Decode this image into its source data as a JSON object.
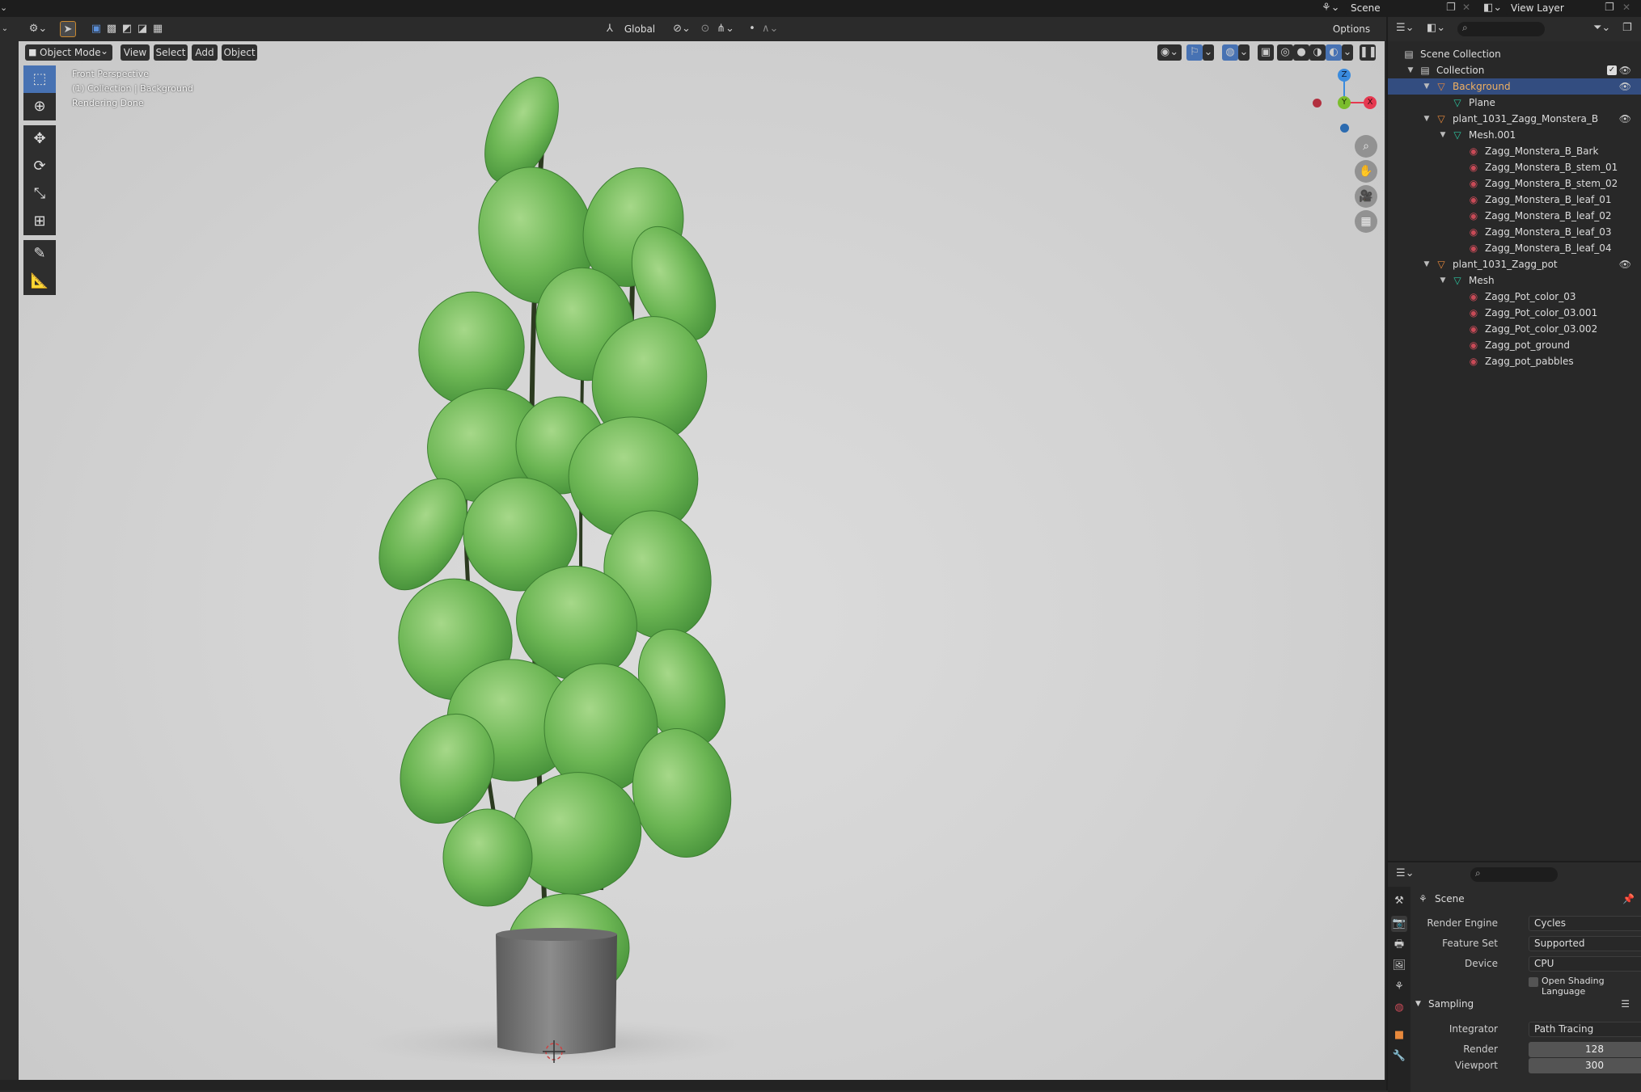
{
  "topbar": {
    "scene_name": "Scene",
    "view_layer_name": "View Layer"
  },
  "viewport_header": {
    "transform_orientation": "Global",
    "options_label": "Options"
  },
  "viewport": {
    "mode": "Object Mode",
    "menus": [
      "View",
      "Select",
      "Add",
      "Object"
    ],
    "overlay_lines": [
      "Front Perspective",
      "(1) Collection | Background",
      "Rendering Done"
    ],
    "gizmo_axes": {
      "z": "Z",
      "y": "Y",
      "x": "X"
    }
  },
  "outliner": {
    "rows": [
      {
        "label": "Scene Collection",
        "type": "scene-collection",
        "depth": 0,
        "selected": false,
        "eye": false
      },
      {
        "label": "Collection",
        "type": "collection",
        "depth": 1,
        "selected": false,
        "eye": true
      },
      {
        "label": "Background",
        "type": "object",
        "depth": 2,
        "selected": true,
        "eye": true
      },
      {
        "label": "Plane",
        "type": "mesh",
        "depth": 3,
        "selected": false,
        "eye": false
      },
      {
        "label": "plant_1031_Zagg_Monstera_B",
        "type": "object",
        "depth": 2,
        "selected": false,
        "eye": true
      },
      {
        "label": "Mesh.001",
        "type": "mesh",
        "depth": 3,
        "selected": false,
        "eye": false
      },
      {
        "label": "Zagg_Monstera_B_Bark",
        "type": "material",
        "depth": 4,
        "selected": false,
        "eye": false
      },
      {
        "label": "Zagg_Monstera_B_stem_01",
        "type": "material",
        "depth": 4,
        "selected": false,
        "eye": false
      },
      {
        "label": "Zagg_Monstera_B_stem_02",
        "type": "material",
        "depth": 4,
        "selected": false,
        "eye": false
      },
      {
        "label": "Zagg_Monstera_B_leaf_01",
        "type": "material",
        "depth": 4,
        "selected": false,
        "eye": false
      },
      {
        "label": "Zagg_Monstera_B_leaf_02",
        "type": "material",
        "depth": 4,
        "selected": false,
        "eye": false
      },
      {
        "label": "Zagg_Monstera_B_leaf_03",
        "type": "material",
        "depth": 4,
        "selected": false,
        "eye": false
      },
      {
        "label": "Zagg_Monstera_B_leaf_04",
        "type": "material",
        "depth": 4,
        "selected": false,
        "eye": false
      },
      {
        "label": "plant_1031_Zagg_pot",
        "type": "object",
        "depth": 2,
        "selected": false,
        "eye": true
      },
      {
        "label": "Mesh",
        "type": "mesh",
        "depth": 3,
        "selected": false,
        "eye": false
      },
      {
        "label": "Zagg_Pot_color_03",
        "type": "material",
        "depth": 4,
        "selected": false,
        "eye": false
      },
      {
        "label": "Zagg_Pot_color_03.001",
        "type": "material",
        "depth": 4,
        "selected": false,
        "eye": false
      },
      {
        "label": "Zagg_Pot_color_03.002",
        "type": "material",
        "depth": 4,
        "selected": false,
        "eye": false
      },
      {
        "label": "Zagg_pot_ground",
        "type": "material",
        "depth": 4,
        "selected": false,
        "eye": false
      },
      {
        "label": "Zagg_pot_pabbles",
        "type": "material",
        "depth": 4,
        "selected": false,
        "eye": false
      }
    ]
  },
  "properties": {
    "context_title": "Scene",
    "render_engine_label": "Render Engine",
    "render_engine_value": "Cycles",
    "feature_set_label": "Feature Set",
    "feature_set_value": "Supported",
    "device_label": "Device",
    "device_value": "CPU",
    "osl_label": "Open Shading Language",
    "sampling_title": "Sampling",
    "integrator_label": "Integrator",
    "integrator_value": "Path Tracing",
    "render_label": "Render",
    "render_value": "128",
    "viewport_label": "Viewport",
    "viewport_value": "300"
  },
  "colors": {
    "selection_blue": "#334d80",
    "active_tool_blue": "#4772b3",
    "object_orange": "#e8893c",
    "mesh_green": "#2bc5a0",
    "material_red": "#c84a57",
    "gizmo_x": "#e63950",
    "gizmo_y": "#7bbd2d",
    "gizmo_z": "#3a8bde"
  }
}
